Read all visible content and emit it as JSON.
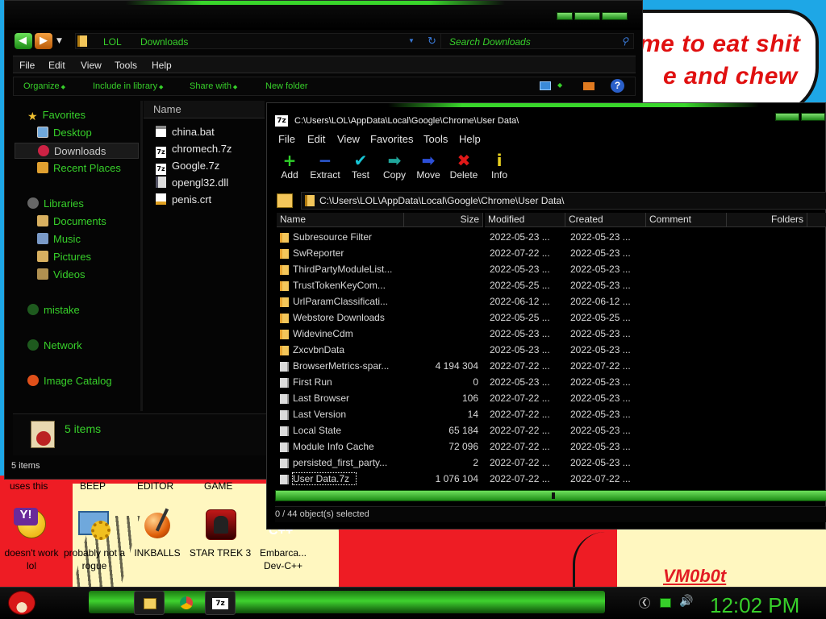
{
  "wallpaper": {
    "bubble_line1": "me to eat shit",
    "bubble_line2": "e and chew",
    "signature": "VM0b0t"
  },
  "desktop": {
    "cut_labels": [
      "uses this",
      "BEEP",
      "EDITOR",
      "GAME"
    ],
    "icons": [
      {
        "label": "doesn't work lol",
        "icon": "yahoo-messenger-icon"
      },
      {
        "label": "probably not a rogue",
        "icon": "settings-gears-icon"
      },
      {
        "label": "INKBALLS",
        "icon": "inkball-icon"
      },
      {
        "label": "STAR TREK 3",
        "icon": "star-trek-game-icon"
      },
      {
        "label": "Embarca... Dev-C++",
        "icon": "devcpp-icon"
      }
    ]
  },
  "explorer": {
    "breadcrumb": [
      "LOL",
      "Downloads"
    ],
    "search_placeholder": "Search Downloads",
    "menu": [
      "File",
      "Edit",
      "View",
      "Tools",
      "Help"
    ],
    "commands": [
      "Organize",
      "Include in library",
      "Share with",
      "New folder"
    ],
    "nav": {
      "favorites_header": "Favorites",
      "favorites": [
        "Desktop",
        "Downloads",
        "Recent Places"
      ],
      "libraries_header": "Libraries",
      "libraries": [
        "Documents",
        "Music",
        "Pictures",
        "Videos"
      ],
      "others": [
        "mistake",
        "Network",
        "Image Catalog"
      ],
      "selected": "Downloads"
    },
    "column_name": "Name",
    "files": [
      {
        "name": "china.bat",
        "icon": "batch-file-icon"
      },
      {
        "name": "chromech.7z",
        "icon": "7z-archive-icon"
      },
      {
        "name": "Google.7z",
        "icon": "7z-archive-icon"
      },
      {
        "name": "opengl32.dll",
        "icon": "dll-file-icon"
      },
      {
        "name": "penis.crt",
        "icon": "certificate-icon"
      }
    ],
    "details_count": "5 items",
    "status": "5 items"
  },
  "sevenzip": {
    "title": "C:\\Users\\LOL\\AppData\\Local\\Google\\Chrome\\User Data\\",
    "menu": [
      "File",
      "Edit",
      "View",
      "Favorites",
      "Tools",
      "Help"
    ],
    "toolbar": [
      {
        "label": "Add",
        "glyph": "+",
        "color": "#2fd12a"
      },
      {
        "label": "Extract",
        "glyph": "−",
        "color": "#2f5fe0"
      },
      {
        "label": "Test",
        "glyph": "✔",
        "color": "#17c6d6"
      },
      {
        "label": "Copy",
        "glyph": "➡",
        "color": "#1fa59a"
      },
      {
        "label": "Move",
        "glyph": "➡",
        "color": "#2c4fd8"
      },
      {
        "label": "Delete",
        "glyph": "✖",
        "color": "#e01818"
      },
      {
        "label": "Info",
        "glyph": "i",
        "color": "#e8d020"
      }
    ],
    "path": "C:\\Users\\LOL\\AppData\\Local\\Google\\Chrome\\User Data\\",
    "columns": [
      "Name",
      "Size",
      "Modified",
      "Created",
      "Comment",
      "Folders"
    ],
    "rows": [
      {
        "name": "Subresource Filter",
        "size": "",
        "modified": "2022-05-23 ...",
        "created": "2022-05-23 ...",
        "type": "folder"
      },
      {
        "name": "SwReporter",
        "size": "",
        "modified": "2022-07-22 ...",
        "created": "2022-05-23 ...",
        "type": "folder"
      },
      {
        "name": "ThirdPartyModuleList...",
        "size": "",
        "modified": "2022-05-23 ...",
        "created": "2022-05-23 ...",
        "type": "folder"
      },
      {
        "name": "TrustTokenKeyCom...",
        "size": "",
        "modified": "2022-05-25 ...",
        "created": "2022-05-23 ...",
        "type": "folder"
      },
      {
        "name": "UrlParamClassificati...",
        "size": "",
        "modified": "2022-06-12 ...",
        "created": "2022-06-12 ...",
        "type": "folder"
      },
      {
        "name": "Webstore Downloads",
        "size": "",
        "modified": "2022-05-25 ...",
        "created": "2022-05-25 ...",
        "type": "folder"
      },
      {
        "name": "WidevineCdm",
        "size": "",
        "modified": "2022-05-23 ...",
        "created": "2022-05-23 ...",
        "type": "folder"
      },
      {
        "name": "ZxcvbnData",
        "size": "",
        "modified": "2022-05-23 ...",
        "created": "2022-05-23 ...",
        "type": "folder"
      },
      {
        "name": "BrowserMetrics-spar...",
        "size": "4 194 304",
        "modified": "2022-07-22 ...",
        "created": "2022-07-22 ...",
        "type": "file"
      },
      {
        "name": "First Run",
        "size": "0",
        "modified": "2022-05-23 ...",
        "created": "2022-05-23 ...",
        "type": "file"
      },
      {
        "name": "Last Browser",
        "size": "106",
        "modified": "2022-07-22 ...",
        "created": "2022-05-23 ...",
        "type": "file"
      },
      {
        "name": "Last Version",
        "size": "14",
        "modified": "2022-07-22 ...",
        "created": "2022-05-23 ...",
        "type": "file"
      },
      {
        "name": "Local State",
        "size": "65 184",
        "modified": "2022-07-22 ...",
        "created": "2022-05-23 ...",
        "type": "file"
      },
      {
        "name": "Module Info Cache",
        "size": "72 096",
        "modified": "2022-07-22 ...",
        "created": "2022-05-23 ...",
        "type": "file"
      },
      {
        "name": "persisted_first_party...",
        "size": "2",
        "modified": "2022-07-22 ...",
        "created": "2022-05-23 ...",
        "type": "file"
      },
      {
        "name": "User Data.7z",
        "size": "1 076 104",
        "modified": "2022-07-22 ...",
        "created": "2022-07-22 ...",
        "type": "file"
      }
    ],
    "status": "0 / 44 object(s) selected"
  },
  "taskbar": {
    "start_icon": "angry-bird-start-icon",
    "buttons": [
      "file-explorer-icon",
      "chrome-icon",
      "7zip-icon"
    ],
    "tray_icons": [
      "back-arrow-icon",
      "network-icon",
      "volume-icon"
    ],
    "clock": "12:02 PM",
    "accent": "#37d02a"
  }
}
